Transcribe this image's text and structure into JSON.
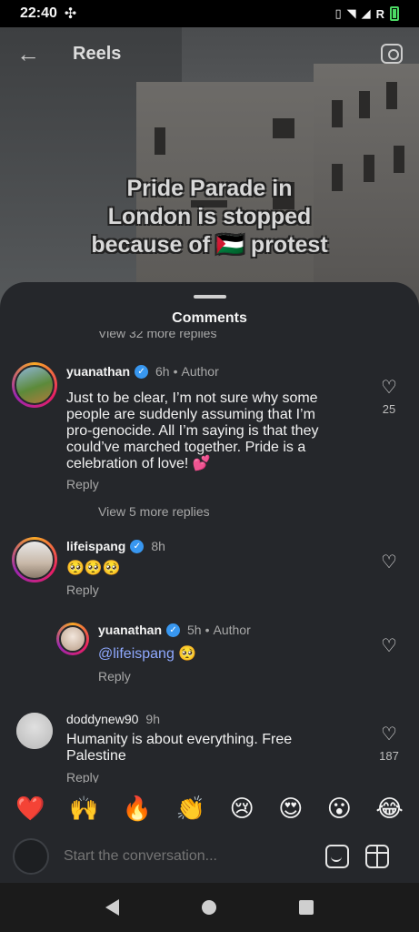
{
  "status_bar": {
    "time": "22:40",
    "carrier_badge": "R"
  },
  "top_nav": {
    "title": "Reels"
  },
  "video": {
    "overlay_lines": [
      "Pride Parade in",
      "London is stopped",
      "because of 🇵🇸 protest"
    ]
  },
  "sheet": {
    "title": "Comments",
    "cut_replies": "View 32 more replies"
  },
  "comments": [
    {
      "user": "yuanathan",
      "time": "6h",
      "author_badge": "Author",
      "text": "Just to be clear, I’m not sure why some people are suddenly assuming that I’m pro-genocide. All I’m saying is that they could’ve marched together. Pride is a celebration of love! 💕",
      "reply": "Reply",
      "likes": "25",
      "view_more": "View 5 more replies"
    },
    {
      "user": "lifeispang",
      "time": "8h",
      "text": "🥺🥺🥺",
      "reply": "Reply"
    },
    {
      "user": "yuanathan",
      "time": "5h",
      "author_badge": "Author",
      "mention": "@lifeispang",
      "text": " 🥺",
      "reply": "Reply"
    },
    {
      "user": "doddynew90",
      "time": "9h",
      "text": "Humanity is about everything. Free Palestine",
      "reply": "Reply",
      "likes": "187"
    }
  ],
  "emoji_bar": [
    "❤️",
    "🙌",
    "🔥",
    "👏",
    "😢",
    "😍",
    "😮",
    "😂"
  ],
  "composer": {
    "placeholder": "Start the conversation..."
  },
  "colors": {
    "sheet": "#25272b",
    "verified": "#3897f0",
    "mention": "#8fa9ff"
  }
}
